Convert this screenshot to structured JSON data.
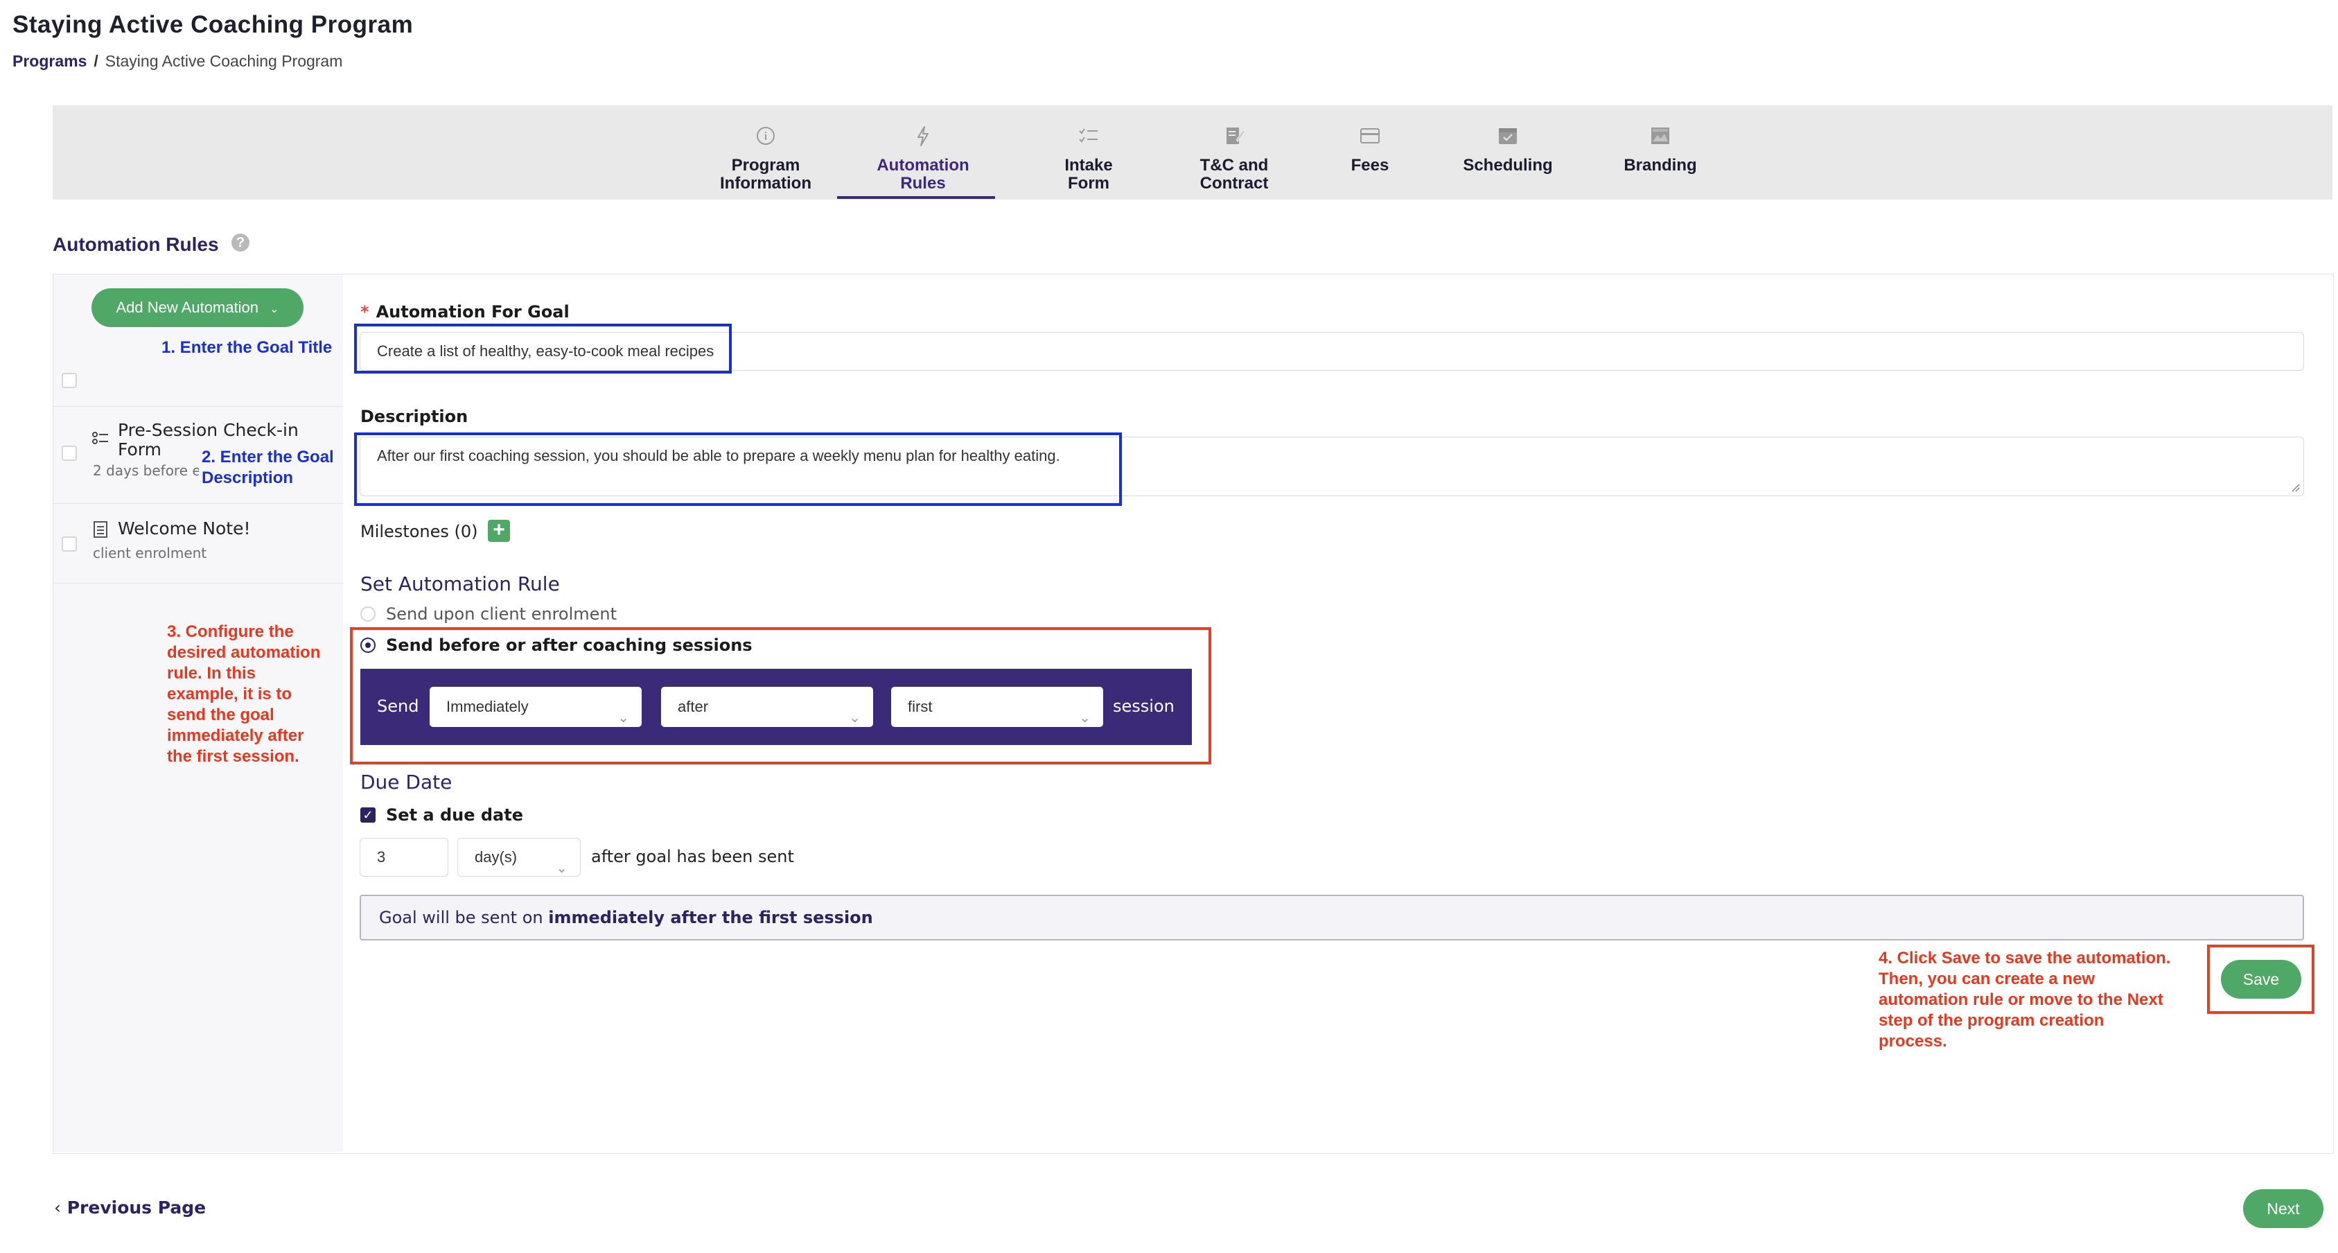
{
  "header": {
    "title": "Staying Active Coaching Program",
    "breadcrumb": {
      "root": "Programs",
      "separator": "/",
      "current": "Staying Active Coaching Program"
    }
  },
  "steps": [
    {
      "line1": "Program",
      "line2": "Information",
      "icon": "info-circle-icon"
    },
    {
      "line1": "Automation",
      "line2": "Rules",
      "icon": "lightning-icon",
      "active": true
    },
    {
      "line1": "Intake",
      "line2": "Form",
      "icon": "checklist-icon"
    },
    {
      "line1": "T&C and",
      "line2": "Contract",
      "icon": "document-edit-icon"
    },
    {
      "line1": "Fees",
      "line2": "",
      "icon": "card-icon"
    },
    {
      "line1": "Scheduling",
      "line2": "",
      "icon": "calendar-icon"
    },
    {
      "line1": "Branding",
      "line2": "",
      "icon": "image-icon"
    }
  ],
  "section": {
    "title": "Automation Rules",
    "help": "?"
  },
  "sidebar": {
    "add_button": "Add New Automation",
    "items": [
      {
        "title": "Pre-Session Check-in",
        "title2": "Form",
        "sub": "2 days before e",
        "icon": "form-list-icon"
      },
      {
        "title": "Welcome Note!",
        "sub": "client enrolment",
        "icon": "note-icon"
      }
    ]
  },
  "form": {
    "goal_label": "Automation For Goal",
    "goal_required": "*",
    "goal_value": "Create a list of healthy, easy-to-cook meal recipes",
    "description_label": "Description",
    "description_value": "After our first coaching session, you should be able to prepare a weekly menu plan for healthy eating.",
    "milestones_label": "Milestones (0)",
    "milestones_add": "+",
    "rule_title": "Set Automation Rule",
    "option_enrolment": "Send upon client enrolment",
    "option_sessions": "Send before or after coaching sessions",
    "rule": {
      "send_label": "Send",
      "timing": "Immediately",
      "relation": "after",
      "which": "first",
      "session_label": "session"
    },
    "due_title": "Due Date",
    "due_checkbox": "Set a due date",
    "due_amount": "3",
    "due_unit": "day(s)",
    "due_suffix": "after goal has been sent",
    "info_prefix": "Goal will be sent on ",
    "info_bold": "immediately after the first session",
    "save": "Save"
  },
  "footer": {
    "previous": "Previous Page",
    "next": "Next"
  },
  "annotations": {
    "a1": "1. Enter the Goal Title",
    "a2_line1": "2. Enter the Goal",
    "a2_line2": "Description",
    "a3": [
      "3. Configure the",
      "desired automation",
      "rule. In this",
      "example, it is to",
      "send the goal",
      "immediately after",
      "the first session."
    ],
    "a4": [
      "4. Click Save to save the automation.",
      "Then, you can create a new",
      "automation rule or move to the Next",
      "step of the program creation",
      "process."
    ]
  },
  "colors": {
    "primary": "#2c2360",
    "accent_green": "#4fa866",
    "rule_bar": "#3b2a78",
    "annotation_blue": "#1a2fd0",
    "annotation_red": "#d9452a"
  }
}
